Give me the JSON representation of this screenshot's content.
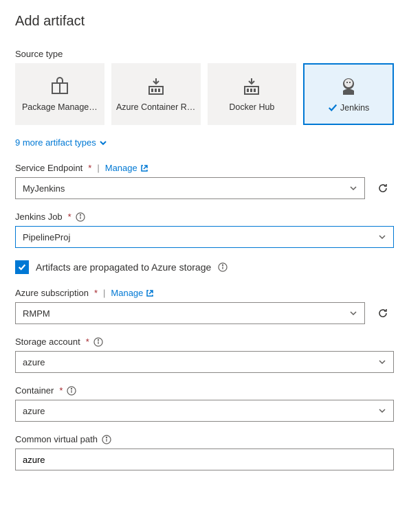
{
  "title": "Add artifact",
  "source_type_label": "Source type",
  "tiles": [
    {
      "label": "Package Manage…"
    },
    {
      "label": "Azure Container R…"
    },
    {
      "label": "Docker Hub"
    },
    {
      "label": "Jenkins"
    }
  ],
  "more_types": "9 more artifact types",
  "service_endpoint": {
    "label": "Service Endpoint",
    "manage": "Manage",
    "value": "MyJenkins"
  },
  "jenkins_job": {
    "label": "Jenkins Job",
    "value": "PipelineProj"
  },
  "propagate": {
    "label": "Artifacts are propagated to Azure storage"
  },
  "azure_sub": {
    "label": "Azure subscription",
    "manage": "Manage",
    "value": "RMPM"
  },
  "storage_account": {
    "label": "Storage account",
    "value": "azure"
  },
  "container": {
    "label": "Container",
    "value": "azure"
  },
  "common_path": {
    "label": "Common virtual path",
    "value": "azure"
  }
}
